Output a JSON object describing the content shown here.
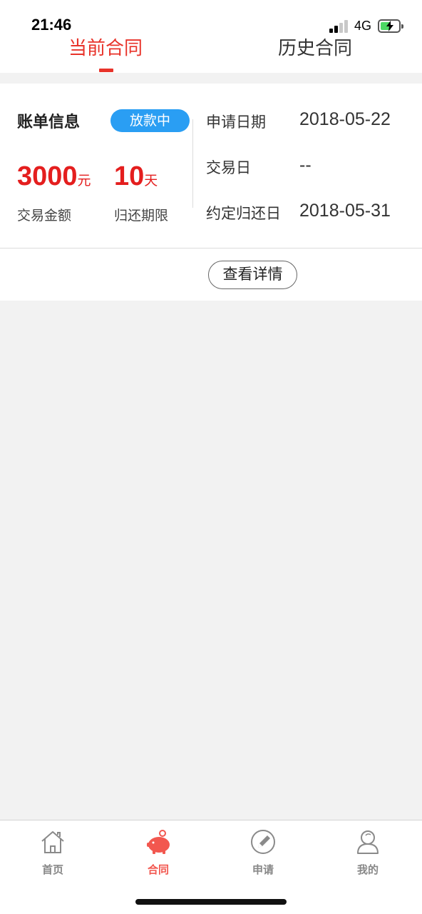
{
  "status_bar": {
    "time": "21:46",
    "network": "4G",
    "battery_color": "#4cd964"
  },
  "tabs": [
    {
      "label": "当前合同",
      "active": true
    },
    {
      "label": "历史合同",
      "active": false
    }
  ],
  "contract": {
    "title": "账单信息",
    "status_badge": "放款中",
    "amount": "3000",
    "amount_unit": "元",
    "amount_label": "交易金额",
    "term": "10",
    "term_unit": "天",
    "term_label": "归还期限",
    "info": [
      {
        "label": "申请日期",
        "value": "2018-05-22"
      },
      {
        "label": "交易日",
        "value": "--"
      },
      {
        "label": "约定归还日",
        "value": "2018-05-31"
      }
    ],
    "detail_button": "查看详情"
  },
  "bottom_nav": [
    {
      "label": "首页",
      "icon": "home-icon",
      "active": false
    },
    {
      "label": "合同",
      "icon": "piggy-bank-icon",
      "active": true
    },
    {
      "label": "申请",
      "icon": "pencil-circle-icon",
      "active": false
    },
    {
      "label": "我的",
      "icon": "user-icon",
      "active": false
    }
  ],
  "colors": {
    "accent": "#e8332a",
    "amount": "#e41e1e",
    "badge": "#2a9ef3",
    "nav_active": "#f2574f"
  }
}
